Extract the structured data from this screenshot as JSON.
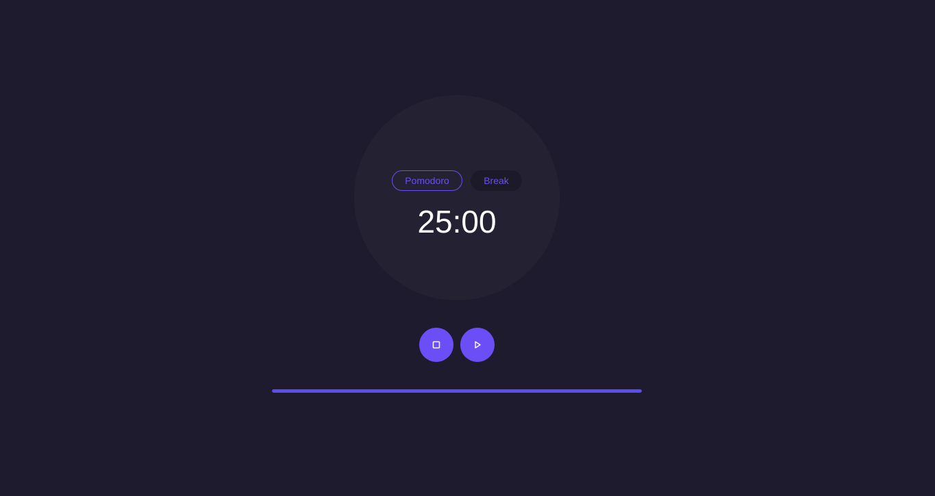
{
  "timer": {
    "modes": [
      {
        "label": "Pomodoro",
        "active": true
      },
      {
        "label": "Break",
        "active": false
      }
    ],
    "time": "25:00"
  },
  "controls": {
    "stop_icon": "stop-icon",
    "play_icon": "play-icon"
  },
  "progress": {
    "fraction": 1.0
  },
  "colors": {
    "background": "#1f1b2e",
    "dial": "#242232",
    "accent": "#6b4ef5",
    "progress": "#5a4cf0",
    "text": "#ffffff"
  }
}
